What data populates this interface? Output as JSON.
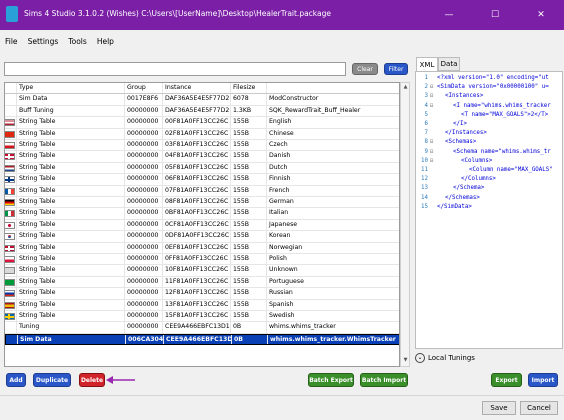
{
  "window": {
    "title": "Sims 4 Studio 3.1.0.2 (Wishes)  C:\\Users\\[UserName]\\Desktop\\HealerTrait.package",
    "min_glyph": "—",
    "max_glyph": "☐",
    "close_glyph": "✕"
  },
  "menu": [
    "File",
    "Settings",
    "Tools",
    "Help"
  ],
  "search": {
    "value": "",
    "clear_label": "Clear",
    "filter_label": "Filter"
  },
  "grid": {
    "columns": [
      "Type",
      "Group",
      "Instance",
      "Filesize",
      ""
    ],
    "rows": [
      {
        "type": "Sim Data",
        "group": "0017E8F6",
        "instance": "DAF36A5E4E5F77D2",
        "size": "6078",
        "name": "ModConstructor",
        "flag": ""
      },
      {
        "type": "Buff Tuning",
        "group": "00000000",
        "instance": "DAF36A5E4E5F77D2",
        "size": "1.3KB",
        "name": "SQK_RewardTrait_Buff_Healer",
        "flag": ""
      },
      {
        "type": "String Table",
        "group": "00000000",
        "instance": "00F81A0FF13CC26C",
        "size": "155B",
        "name": "English",
        "flag": "us"
      },
      {
        "type": "String Table",
        "group": "00000000",
        "instance": "02F81A0FF13CC26C",
        "size": "155B",
        "name": "Chinese",
        "flag": "cn"
      },
      {
        "type": "String Table",
        "group": "00000000",
        "instance": "03F81A0FF13CC26C",
        "size": "155B",
        "name": "Czech",
        "flag": "cz"
      },
      {
        "type": "String Table",
        "group": "00000000",
        "instance": "04F81A0FF13CC26C",
        "size": "155B",
        "name": "Danish",
        "flag": "dk"
      },
      {
        "type": "String Table",
        "group": "00000000",
        "instance": "05F81A0FF13CC26C",
        "size": "155B",
        "name": "Dutch",
        "flag": "nl"
      },
      {
        "type": "String Table",
        "group": "00000000",
        "instance": "06F81A0FF13CC26C",
        "size": "155B",
        "name": "Finnish",
        "flag": "fi"
      },
      {
        "type": "String Table",
        "group": "00000000",
        "instance": "07F81A0FF13CC26C",
        "size": "155B",
        "name": "French",
        "flag": "fr"
      },
      {
        "type": "String Table",
        "group": "00000000",
        "instance": "08F81A0FF13CC26C",
        "size": "155B",
        "name": "German",
        "flag": "de"
      },
      {
        "type": "String Table",
        "group": "00000000",
        "instance": "0BF81A0FF13CC26C",
        "size": "155B",
        "name": "Italian",
        "flag": "it"
      },
      {
        "type": "String Table",
        "group": "00000000",
        "instance": "0CF81A0FF13CC26C",
        "size": "155B",
        "name": "Japanese",
        "flag": "jp"
      },
      {
        "type": "String Table",
        "group": "00000000",
        "instance": "0DF81A0FF13CC26C",
        "size": "155B",
        "name": "Korean",
        "flag": "kr"
      },
      {
        "type": "String Table",
        "group": "00000000",
        "instance": "0EF81A0FF13CC26C",
        "size": "155B",
        "name": "Norwegian",
        "flag": "no"
      },
      {
        "type": "String Table",
        "group": "00000000",
        "instance": "0FF81A0FF13CC26C",
        "size": "155B",
        "name": "Polish",
        "flag": "pl"
      },
      {
        "type": "String Table",
        "group": "00000000",
        "instance": "10F81A0FF13CC26C",
        "size": "155B",
        "name": "Unknown",
        "flag": "un"
      },
      {
        "type": "String Table",
        "group": "00000000",
        "instance": "11F81A0FF13CC26C",
        "size": "155B",
        "name": "Portuguese",
        "flag": "br"
      },
      {
        "type": "String Table",
        "group": "00000000",
        "instance": "12F81A0FF13CC26C",
        "size": "155B",
        "name": "Russian",
        "flag": "ru"
      },
      {
        "type": "String Table",
        "group": "00000000",
        "instance": "13F81A0FF13CC26C",
        "size": "155B",
        "name": "Spanish",
        "flag": "es"
      },
      {
        "type": "String Table",
        "group": "00000000",
        "instance": "15F81A0FF13CC26C",
        "size": "155B",
        "name": "Swedish",
        "flag": "se"
      },
      {
        "type": "Tuning",
        "group": "00000000",
        "instance": "CEE9A466EBFC13D1",
        "size": "0B",
        "name": "whims.whims_tracker",
        "flag": ""
      },
      {
        "type": "Sim Data",
        "group": "006CA304",
        "instance": "CEE9A466EBFC13D1",
        "size": "0B",
        "name": "whims.whims_tracker.WhimsTracker",
        "flag": "",
        "selected": true
      }
    ]
  },
  "xml_panel": {
    "tabs": [
      "XML",
      "Data"
    ],
    "lines": [
      {
        "n": "1",
        "fold": "",
        "indent": 0,
        "code": "<?xml version=\"1.0\" encoding=\"ut"
      },
      {
        "n": "2",
        "fold": "⊟",
        "indent": 0,
        "code": "<SimData version=\"0x00000100\" u="
      },
      {
        "n": "3",
        "fold": "⊟",
        "indent": 1,
        "code": "<Instances>"
      },
      {
        "n": "4",
        "fold": "⊟",
        "indent": 2,
        "code": "<I name=\"whims.whims_tracker"
      },
      {
        "n": "5",
        "fold": "",
        "indent": 3,
        "code": "<T name=\"MAX_GOALS\">2</T>"
      },
      {
        "n": "6",
        "fold": "",
        "indent": 2,
        "code": "</I>"
      },
      {
        "n": "7",
        "fold": "",
        "indent": 1,
        "code": "</Instances>"
      },
      {
        "n": "8",
        "fold": "⊟",
        "indent": 1,
        "code": "<Schemas>"
      },
      {
        "n": "9",
        "fold": "⊟",
        "indent": 2,
        "code": "<Schema name=\"whims.whims_tr"
      },
      {
        "n": "10",
        "fold": "⊟",
        "indent": 3,
        "code": "<Columns>"
      },
      {
        "n": "11",
        "fold": "",
        "indent": 4,
        "code": "<Column name=\"MAX_GOALS\""
      },
      {
        "n": "12",
        "fold": "",
        "indent": 3,
        "code": "</Columns>"
      },
      {
        "n": "13",
        "fold": "",
        "indent": 2,
        "code": "</Schema>"
      },
      {
        "n": "14",
        "fold": "",
        "indent": 1,
        "code": "</Schemas>"
      },
      {
        "n": "15",
        "fold": "",
        "indent": 0,
        "code": "</SimData>"
      }
    ],
    "local_tunings_label": "Local Tunings",
    "expand_glyph": "⌄"
  },
  "actions": {
    "add": "Add",
    "duplicate": "Duplicate",
    "delete": "Delete",
    "batch_export": "Batch Export",
    "batch_import": "Batch Import",
    "export": "Export",
    "import": "Import"
  },
  "footer": {
    "save": "Save",
    "cancel": "Cancel"
  },
  "colors": {
    "titlebar": "#7a1fa6",
    "selection": "#0a40b5",
    "blue_button": "#2a57c8",
    "red_button": "#d1232a",
    "green_button": "#3b8f2b",
    "annotation_arrow": "#9a27b0"
  }
}
